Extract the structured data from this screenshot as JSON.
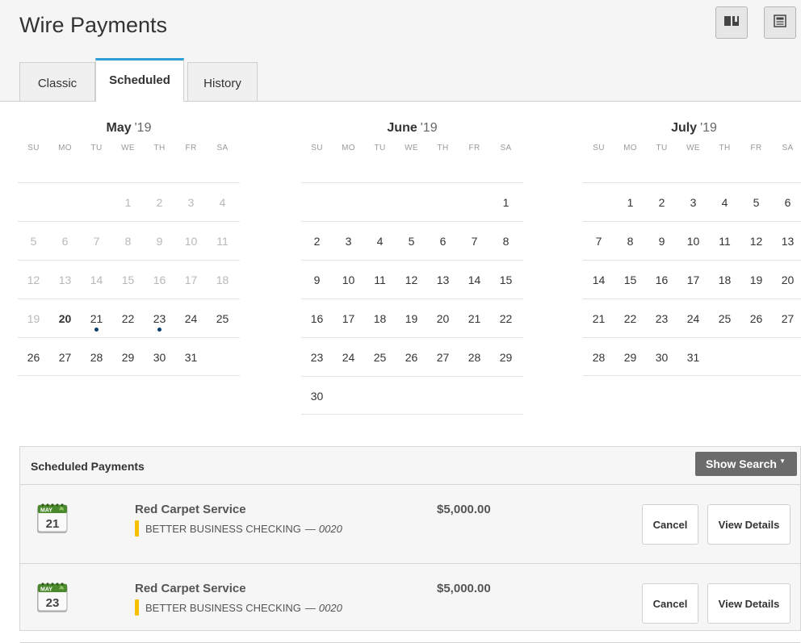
{
  "page": {
    "title": "Wire Payments"
  },
  "toolbar": {
    "buttons": [
      {
        "icon": "book-icon"
      },
      {
        "icon": "newspaper-icon"
      }
    ]
  },
  "tabs": [
    {
      "label": "Classic",
      "active": false
    },
    {
      "label": "Scheduled",
      "active": true
    },
    {
      "label": "History",
      "active": false
    }
  ],
  "weekdays": [
    "SU",
    "MO",
    "TU",
    "WE",
    "TH",
    "FR",
    "SA"
  ],
  "calendars": [
    {
      "month": "May",
      "year": "'19",
      "weeks": [
        [
          "",
          "",
          "",
          "1",
          "2",
          "3",
          "4"
        ],
        [
          "5",
          "6",
          "7",
          "8",
          "9",
          "10",
          "11"
        ],
        [
          "12",
          "13",
          "14",
          "15",
          "16",
          "17",
          "18"
        ],
        [
          "19",
          "20",
          "21",
          "22",
          "23",
          "24",
          "25"
        ],
        [
          "26",
          "27",
          "28",
          "29",
          "30",
          "31",
          ""
        ]
      ],
      "past_before_day": 20,
      "today": 20,
      "scheduled_days": [
        21,
        23
      ]
    },
    {
      "month": "June",
      "year": "'19",
      "weeks": [
        [
          "",
          "",
          "",
          "",
          "",
          "",
          "1"
        ],
        [
          "2",
          "3",
          "4",
          "5",
          "6",
          "7",
          "8"
        ],
        [
          "9",
          "10",
          "11",
          "12",
          "13",
          "14",
          "15"
        ],
        [
          "16",
          "17",
          "18",
          "19",
          "20",
          "21",
          "22"
        ],
        [
          "23",
          "24",
          "25",
          "26",
          "27",
          "28",
          "29"
        ],
        [
          "30",
          "",
          "",
          "",
          "",
          "",
          ""
        ]
      ],
      "past_before_day": 0,
      "today": 0,
      "scheduled_days": []
    },
    {
      "month": "July",
      "year": "'19",
      "weeks": [
        [
          "",
          "1",
          "2",
          "3",
          "4",
          "5",
          "6"
        ],
        [
          "7",
          "8",
          "9",
          "10",
          "11",
          "12",
          "13"
        ],
        [
          "14",
          "15",
          "16",
          "17",
          "18",
          "19",
          "20"
        ],
        [
          "21",
          "22",
          "23",
          "24",
          "25",
          "26",
          "27"
        ],
        [
          "28",
          "29",
          "30",
          "31",
          "",
          "",
          ""
        ]
      ],
      "past_before_day": 0,
      "today": 0,
      "scheduled_days": []
    }
  ],
  "scheduled": {
    "title": "Scheduled Payments",
    "show_search_label": "Show Search",
    "payments": [
      {
        "month": "MAY",
        "day": "21",
        "payee": "Red Carpet Service",
        "account": "BETTER BUSINESS CHECKING",
        "account_sep": "—",
        "account_number": "0020",
        "amount": "$5,000.00",
        "cancel_label": "Cancel",
        "details_label": "View Details"
      },
      {
        "month": "MAY",
        "day": "23",
        "payee": "Red Carpet Service",
        "account": "BETTER BUSINESS CHECKING",
        "account_sep": "—",
        "account_number": "0020",
        "amount": "$5,000.00",
        "cancel_label": "Cancel",
        "details_label": "View Details"
      }
    ]
  },
  "colors": {
    "tab_accent": "#2d9fd8",
    "account_marker": "#f5c000",
    "scheduled_dot": "#0c3e6b",
    "calendar_icon_green": "#4b8a2c"
  }
}
